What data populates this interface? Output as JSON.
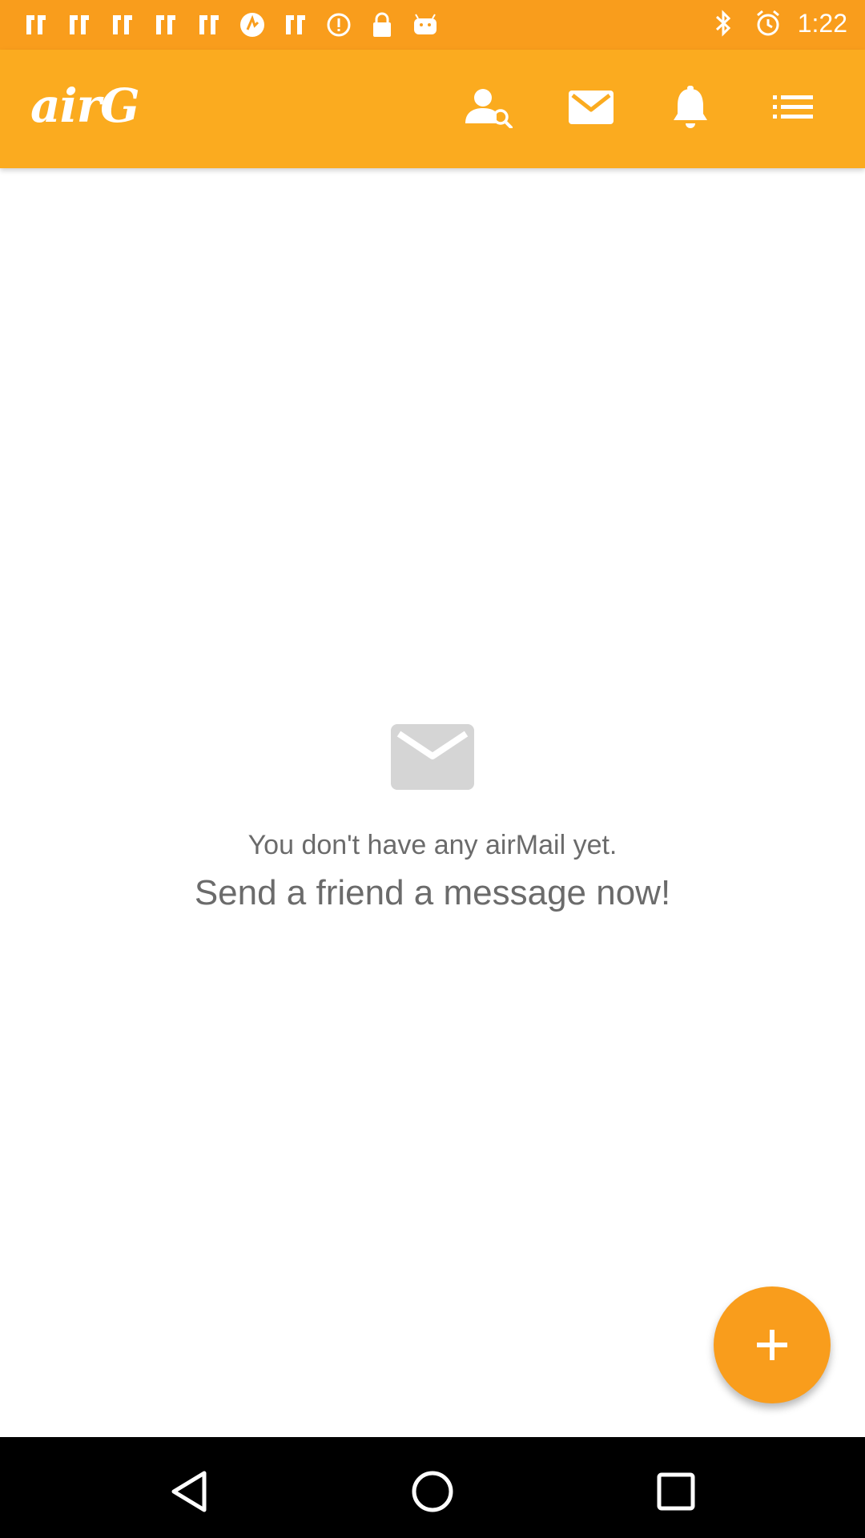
{
  "status_bar": {
    "time": "1:22",
    "left_icons": [
      "app-notification-icon",
      "app-notification-icon",
      "app-notification-icon",
      "app-notification-icon",
      "app-notification-icon",
      "airg-notification-icon",
      "app-notification-icon",
      "info-icon",
      "lock-icon",
      "android-icon"
    ],
    "right_icons": [
      "bluetooth-icon",
      "alarm-icon"
    ],
    "color": "#f99d1c"
  },
  "app_bar": {
    "logo": "airG",
    "color": "#fbab1f",
    "icons": [
      "people-search-icon",
      "mail-icon",
      "bell-icon",
      "list-icon"
    ]
  },
  "empty_state": {
    "icon": "mail-icon",
    "line1": "You don't have any airMail yet.",
    "line2": "Send a friend a message now!"
  },
  "fab": {
    "icon": "plus-icon",
    "color": "#f99d1c"
  },
  "nav_bar": {
    "icons": [
      "back-icon",
      "home-icon",
      "recent-apps-icon"
    ]
  }
}
